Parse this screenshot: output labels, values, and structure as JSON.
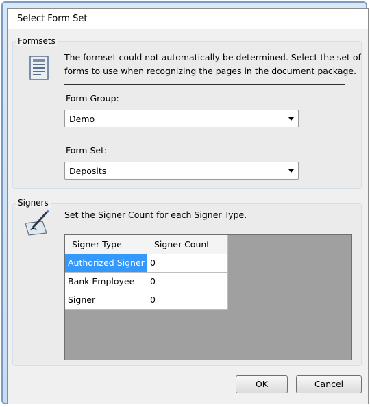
{
  "dialog": {
    "title": "Select Form Set"
  },
  "formsets": {
    "group_label": "Formsets",
    "description_line1": "The formset could not automatically be determined.  Select the set of",
    "description_line2": "forms to use when recognizing the pages in the document package.",
    "icon": "form-list-icon",
    "form_group_label": "Form Group:",
    "form_group_value": "Demo",
    "form_set_label": "Form Set:",
    "form_set_value": "Deposits"
  },
  "signers": {
    "group_label": "Signers",
    "icon": "signature-pen-icon",
    "description": "Set the Signer Count for each Signer Type.",
    "columns": [
      "Signer Type",
      "Signer Count"
    ],
    "rows": [
      {
        "type": "Authorized Signer",
        "count": "0",
        "selected": true
      },
      {
        "type": "Bank Employee",
        "count": "0",
        "selected": false
      },
      {
        "type": "Signer",
        "count": "0",
        "selected": false
      }
    ]
  },
  "buttons": {
    "ok": "OK",
    "cancel": "Cancel"
  },
  "colors": {
    "selection": "#3399ff",
    "window_frame": "#7a9cc4"
  }
}
